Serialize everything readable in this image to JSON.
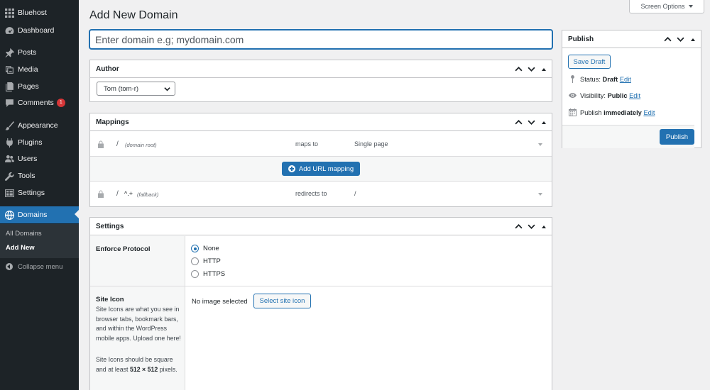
{
  "sidebar": {
    "items": [
      {
        "label": "Bluehost",
        "icon": "grid-icon"
      },
      {
        "label": "Dashboard",
        "icon": "dashboard-icon"
      },
      {
        "label": "Posts",
        "icon": "pin-icon"
      },
      {
        "label": "Media",
        "icon": "media-icon"
      },
      {
        "label": "Pages",
        "icon": "pages-icon"
      },
      {
        "label": "Comments",
        "icon": "comment-icon",
        "badge": "1"
      },
      {
        "label": "Appearance",
        "icon": "brush-icon"
      },
      {
        "label": "Plugins",
        "icon": "plug-icon"
      },
      {
        "label": "Users",
        "icon": "users-icon"
      },
      {
        "label": "Tools",
        "icon": "wrench-icon"
      },
      {
        "label": "Settings",
        "icon": "settings-icon"
      },
      {
        "label": "Domains",
        "icon": "globe-icon",
        "current": true
      }
    ],
    "submenu": [
      {
        "label": "All Domains"
      },
      {
        "label": "Add New",
        "active": true
      }
    ],
    "collapse_label": "Collapse menu"
  },
  "header": {
    "title": "Add New Domain",
    "screen_options": "Screen Options"
  },
  "domain_input": {
    "placeholder": "Enter domain e.g; mydomain.com",
    "value": ""
  },
  "author": {
    "title": "Author",
    "selected": "Tom (tom-r)"
  },
  "mappings": {
    "title": "Mappings",
    "rows": [
      {
        "path": "/",
        "hint": "(domain root)",
        "action": "maps to",
        "target": "Single page"
      },
      {
        "path": "/",
        "pattern": "^.+",
        "hint": "(fallback)",
        "action": "redirects to",
        "target": "/"
      }
    ],
    "add_label": "Add URL mapping"
  },
  "settings": {
    "title": "Settings",
    "enforce_protocol": {
      "label": "Enforce Protocol",
      "options": [
        "None",
        "HTTP",
        "HTTPS"
      ],
      "selected": "None"
    },
    "site_icon": {
      "label": "Site Icon",
      "desc1": "Site Icons are what you see in browser tabs, bookmark bars, and within the WordPress mobile apps. Upload one here!",
      "desc2_pre": "Site Icons should be square and at least ",
      "desc2_size": "512 × 512",
      "desc2_post": " pixels.",
      "no_image": "No image selected",
      "select_label": "Select site icon"
    }
  },
  "publish": {
    "title": "Publish",
    "save_draft": "Save Draft",
    "status_label": "Status:",
    "status_value": "Draft",
    "visibility_label": "Visibility:",
    "visibility_value": "Public",
    "schedule_label": "Publish",
    "schedule_value": "immediately",
    "edit": "Edit",
    "publish_button": "Publish"
  },
  "colors": {
    "sidebar_bg": "#1d2327",
    "accent": "#2271b1",
    "badge": "#d63638",
    "page_bg": "#f0f0f1"
  }
}
